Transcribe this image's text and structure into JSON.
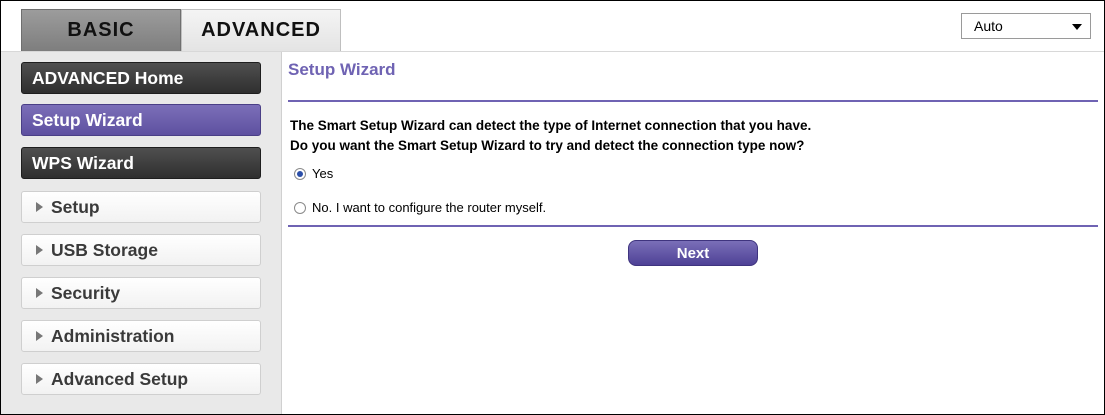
{
  "tabs": {
    "basic": "BASIC",
    "advanced": "ADVANCED"
  },
  "language": {
    "selected": "Auto"
  },
  "sidebar": {
    "items": [
      {
        "label": "ADVANCED Home"
      },
      {
        "label": "Setup Wizard"
      },
      {
        "label": "WPS Wizard"
      },
      {
        "label": "Setup"
      },
      {
        "label": "USB Storage"
      },
      {
        "label": "Security"
      },
      {
        "label": "Administration"
      },
      {
        "label": "Advanced Setup"
      }
    ]
  },
  "main": {
    "title": "Setup Wizard",
    "description_line1": "The Smart Setup Wizard can detect the type of Internet connection that you have.",
    "description_line2": "Do you want the Smart Setup Wizard to try and detect the connection type now?",
    "options": [
      {
        "label": "Yes",
        "selected": true
      },
      {
        "label": "No. I want to configure the router myself.",
        "selected": false
      }
    ],
    "next_label": "Next"
  },
  "colors": {
    "accent": "#6f63b3",
    "dark_nav": "#3a3a3a",
    "active_nav": "#6a5dab"
  }
}
